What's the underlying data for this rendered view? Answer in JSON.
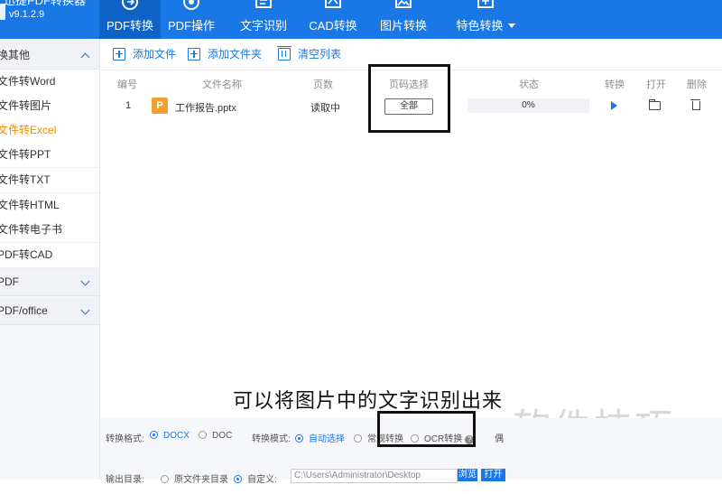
{
  "app": {
    "title": "迅捷PDF转换器",
    "version": "v9.1.2.9"
  },
  "nav": {
    "tabs": [
      {
        "label": "PDF转换",
        "icon": "convert-icon"
      },
      {
        "label": "PDF操作",
        "icon": "pdf-tools-icon"
      },
      {
        "label": "文字识别",
        "icon": "ocr-icon"
      },
      {
        "label": "CAD转换",
        "icon": "cad-icon"
      },
      {
        "label": "图片转换",
        "icon": "image-icon"
      },
      {
        "label": "特色转换",
        "icon": "special-icon"
      }
    ]
  },
  "sidebar": {
    "group_other": "换其他",
    "items": [
      "文件转Word",
      "文件转图片",
      "文件转Excel",
      "文件转PPT",
      "文件转TXT",
      "文件转HTML",
      "文件转电子书",
      "PDF转CAD"
    ],
    "group_pdf": "PDF",
    "group_pdf_office": "PDF/office"
  },
  "toolbar": {
    "add_file": "添加文件",
    "add_folder": "添加文件夹",
    "clear_list": "清空列表"
  },
  "table": {
    "headers": {
      "num": "编号",
      "name": "文件名称",
      "pages": "页数",
      "page_select": "页码选择",
      "status": "状态",
      "convert": "转换",
      "open": "打开",
      "delete": "删除"
    },
    "row": {
      "num": "1",
      "icon_letter": "P",
      "name": "工作报告.pptx",
      "pages": "读取中",
      "page_select": "全部",
      "progress": "0%",
      "progress_value": 0
    }
  },
  "caption": "可以将图片中的文字识别出来",
  "watermark": "软件技巧",
  "bottom": {
    "format_label": "转换格式:",
    "format_docx": "DOCX",
    "format_doc": "DOC",
    "mode_label": "转换模式:",
    "mode_auto": "自动选择",
    "mode_normal": "常规转换",
    "mode_ocr": "OCR转换",
    "partial_label": "偶",
    "output_label": "输出目录:",
    "output_source": "原文件夹目录",
    "output_custom": "自定义:",
    "output_path": "C:\\Users\\Administrator\\Desktop",
    "browse_btn": "浏览",
    "open_btn": "打开文"
  },
  "colors": {
    "brand_blue": "#1a78e6",
    "active_orange": "#f08c00",
    "highlight_box": "#111111"
  }
}
